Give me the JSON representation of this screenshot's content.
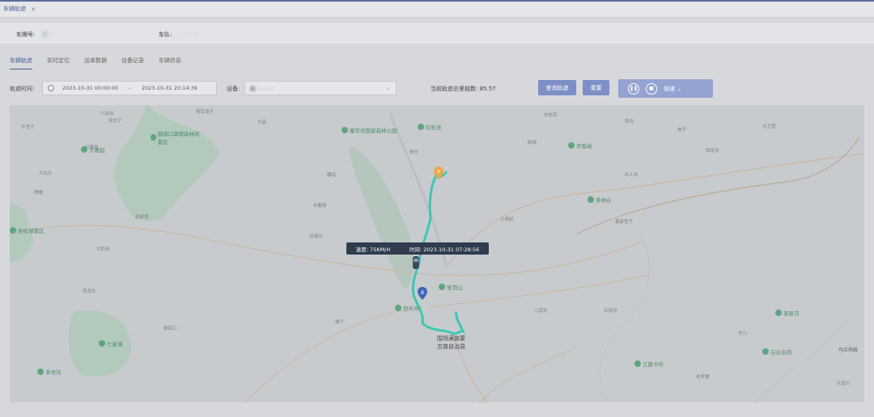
{
  "tab": {
    "title": "车辆轨迹",
    "close": "×"
  },
  "info": {
    "plate_label": "车牌号:",
    "plate_value": "冀·····",
    "fleet_label": "车队:",
    "fleet_value": "··········"
  },
  "subtabs": [
    "车辆轨迹",
    "实时定位",
    "运单数据",
    "设备记录",
    "车辆信息"
  ],
  "filter": {
    "time_label": "轨迹时间:",
    "start": "2023-10-31 00:00:00",
    "sep": "-",
    "end": "2023-10-31 20:14:39",
    "device_label": "设备:",
    "device_value": "冀···········",
    "mileage": "当前轨迹总里程数:  85.57",
    "query_btn": "查询轨迹",
    "reset_btn": "重置",
    "speed_label": "倍速"
  },
  "tooltip": {
    "speed": "速度:   75KM/H",
    "time": "时间:  2023-10-31 07:28:56"
  },
  "county": {
    "line1": "围场满族蒙",
    "line2": "古族自治县"
  },
  "markers": {
    "start": "P",
    "end": "B"
  },
  "map": {
    "towns": [
      "八仙台",
      "将军泡子",
      "双岔子",
      "大庙",
      "不苍子",
      "东岭后",
      "西沟",
      "大王营",
      "甸子",
      "兴隆地",
      "桥头",
      "新拨",
      "西龙头",
      "腰站",
      "大石头",
      "石人沟",
      "牌楼",
      "半截塔",
      "张家湾",
      "大唤起",
      "姜家营子",
      "大西沟",
      "边墙山",
      "二道沟",
      "五道沟",
      "西龙头",
      "御道口",
      "东川",
      "城子",
      "老窝铺"
    ],
    "pois": [
      "塞罕坝国家森林公园",
      "御道口草原森林风景区",
      "大唤起",
      "红松洼",
      "多伦湖景区",
      "灵狐峪",
      "美林谷",
      "宝顶山",
      "七星湖",
      "多坝沟",
      "巴头沟",
      "滚泉沟",
      "白云古洞",
      "兰旗卡伦",
      "头道川",
      "乌兰布统",
      "沙胡子沟",
      "七家温泉",
      "苗沟"
    ]
  },
  "colors": {
    "accent": "#4a5f9a",
    "track": "#3ec7b4",
    "tooltip_bg": "#2f3b4e"
  }
}
